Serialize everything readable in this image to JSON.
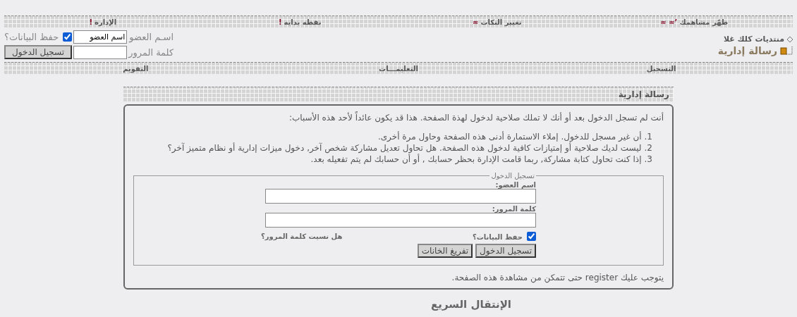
{
  "top_nav": [
    {
      "label": "طهّر مشاهمك",
      "marks": "’≈ ≈"
    },
    {
      "label": "تغيير النكات",
      "marks": "≈"
    },
    {
      "label": "نقطه بدايه",
      "marks": "!"
    },
    {
      "label": "الإدارة",
      "marks": "!"
    }
  ],
  "header": {
    "site_name": "منتديات كلك غلا",
    "page_title": "رسالة إدارية"
  },
  "quick_login": {
    "username_label": "اسـم العضو",
    "username_value": "اسم العضو",
    "remember_label": "حفظ البيانات؟",
    "remember_checked": true,
    "password_label": "كلمة المرور",
    "button": "تسجيل الدخول"
  },
  "sub_nav": [
    {
      "label": "التسجيل"
    },
    {
      "label": "التعليمـــات"
    },
    {
      "label": "التقويم"
    }
  ],
  "message": {
    "title": "رسالة إدارية",
    "intro": "أنت لم تسجل الدخول بعد أو أنك لا تملك صلاحية لدخول لهذة الصفحة. هذا قد يكون عائداً لأحد هذه الأسباب:",
    "reasons": [
      {
        "marker": "1.",
        "text": "أن غير مسجل للدخول. إملاء الاستمارة أدنى هذه الصفحة وحاول مرة أخرى."
      },
      {
        "marker": "2.",
        "text": "ليست لديك صلاحية أو إمتيازات كافية لدخول هذه الصفحة. هل تحاول تعديل مشاركة شخص آخر, دخول ميزات إدارية أو نظام متميز آخر؟"
      },
      {
        "marker": "3.",
        "text": "إذا كنت تحاول كتابة مشاركة, ربما قامت الإدارة بحظر حسابك , أو أن حسابك لم يتم تفعيله بعد."
      }
    ],
    "login": {
      "legend": "تسجيل الدخول",
      "username_label": "اسم العضو:",
      "password_label": "كلمة المرور:",
      "remember_label": "حفظ البيانات؟",
      "remember_checked": true,
      "forgot_link": "هل نسيت كلمة المرور؟",
      "buttons": [
        "تسجيل الدخول",
        "تفريغ الخانات"
      ]
    },
    "footer_before": "يتوجب عليك",
    "footer_link": "register",
    "footer_after": "حتى تتمكن من مشاهدة هذه الصفحة."
  },
  "quick_jump": {
    "title": "الإنتقال السريع"
  }
}
